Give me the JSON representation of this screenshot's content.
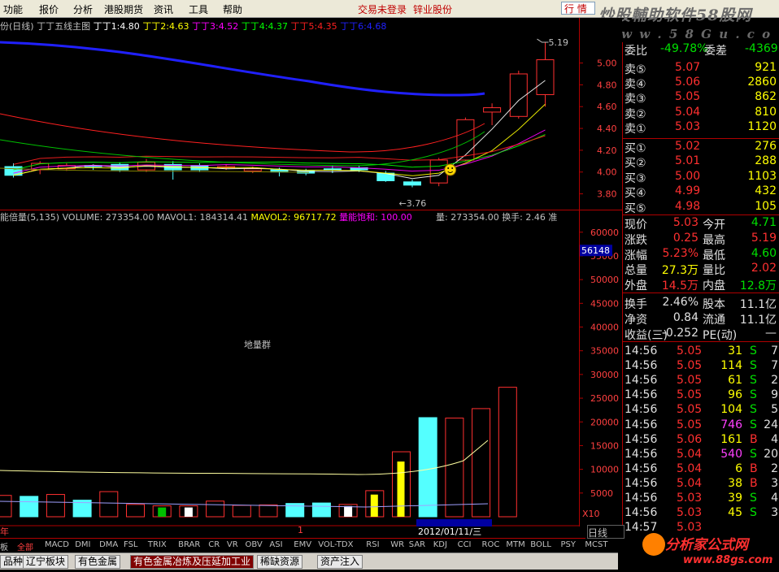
{
  "menu": {
    "items": [
      "功能",
      "报价",
      "分析",
      "港股期货",
      "资讯",
      "工具",
      "帮助"
    ],
    "status": "交易未登录",
    "stock_name": "锌业股份",
    "search_text": "行 情"
  },
  "watermark": {
    "line1": "炒股輔助软件58股网",
    "line2": "w w w . 5 8 G u . c o m"
  },
  "kline_header": {
    "title": "份(日线)",
    "indicator": "丁丁五线主图",
    "items": [
      {
        "label": "丁丁1:",
        "value": "4.80",
        "color": "#ffffff"
      },
      {
        "label": "丁丁2:",
        "value": "4.63",
        "color": "#ffff00"
      },
      {
        "label": "丁丁3:",
        "value": "4.52",
        "color": "#ff00ff"
      },
      {
        "label": "丁丁4:",
        "value": "4.37",
        "color": "#00ff00"
      },
      {
        "label": "丁丁5:",
        "value": "4.35",
        "color": "#ff2020"
      },
      {
        "label": "丁丁6:",
        "value": "4.68",
        "color": "#2020ff"
      }
    ]
  },
  "kline": {
    "yticks": [
      "5.00",
      "4.80",
      "4.60",
      "4.40",
      "4.20",
      "4.00",
      "3.80"
    ],
    "high_label": "5.19",
    "low_label": "←3.76",
    "candles": [
      {
        "o": 4.05,
        "c": 3.97,
        "h": 4.08,
        "l": 3.95
      },
      {
        "o": 4.02,
        "c": 4.08,
        "h": 4.1,
        "l": 3.98
      },
      {
        "o": 4.03,
        "c": 4.06,
        "h": 4.08,
        "l": 4.01
      },
      {
        "o": 4.06,
        "c": 4.05,
        "h": 4.07,
        "l": 4.02
      },
      {
        "o": 4.07,
        "c": 4.02,
        "h": 4.09,
        "l": 4.0
      },
      {
        "o": 4.02,
        "c": 4.09,
        "h": 4.12,
        "l": 4.0
      },
      {
        "o": 4.07,
        "c": 4.02,
        "h": 4.1,
        "l": 3.93
      },
      {
        "o": 4.06,
        "c": 4.02,
        "h": 4.08,
        "l": 4.0
      },
      {
        "o": 4.05,
        "c": 4.05,
        "h": 4.07,
        "l": 4.02
      },
      {
        "o": 4.01,
        "c": 4.03,
        "h": 4.05,
        "l": 3.99
      },
      {
        "o": 4.02,
        "c": 4.0,
        "h": 4.04,
        "l": 3.96
      },
      {
        "o": 4.01,
        "c": 3.99,
        "h": 4.03,
        "l": 3.97
      },
      {
        "o": 4.03,
        "c": 4.02,
        "h": 4.06,
        "l": 3.99
      },
      {
        "o": 4.04,
        "c": 4.02,
        "h": 4.06,
        "l": 4.0
      },
      {
        "o": 3.99,
        "c": 3.92,
        "h": 4.01,
        "l": 3.91
      },
      {
        "o": 3.91,
        "c": 3.88,
        "h": 3.93,
        "l": 3.86
      },
      {
        "o": 3.9,
        "c": 4.11,
        "h": 4.13,
        "l": 3.87
      },
      {
        "o": 4.11,
        "c": 4.48,
        "h": 4.5,
        "l": 4.1
      },
      {
        "o": 4.55,
        "c": 4.59,
        "h": 4.63,
        "l": 4.43
      },
      {
        "o": 4.51,
        "c": 4.9,
        "h": 4.93,
        "l": 4.49
      },
      {
        "o": 4.71,
        "c": 5.03,
        "h": 5.19,
        "l": 4.6
      }
    ]
  },
  "vol_header": {
    "title": "能倍量(5,135)",
    "volume": "VOLUME: 273354.00",
    "mavol1": "MAVOL1: 184314.41",
    "mavol2": "MAVOL2: 96717.72",
    "saturation": "量能饱和: 100.00",
    "right": "量: 273354.00",
    "turnover": "换手: 2.46",
    "turnover_mark": "准"
  },
  "volume": {
    "yticks": [
      "60000",
      "55000",
      "50000",
      "45000",
      "40000",
      "35000",
      "30000",
      "25000",
      "20000",
      "15000",
      "10000",
      "5000"
    ],
    "current_label": "56148",
    "multiplier": "X10",
    "ground_label": "地量群",
    "bars": [
      {
        "v": 4500,
        "type": "down"
      },
      {
        "v": 4300,
        "type": "cyan"
      },
      {
        "v": 4700,
        "type": "down"
      },
      {
        "v": 3500,
        "type": "cyan"
      },
      {
        "v": 5300,
        "type": "down"
      },
      {
        "v": 2600,
        "type": "down"
      },
      {
        "v": 2300,
        "type": "green"
      },
      {
        "v": 2300,
        "type": "white"
      },
      {
        "v": 3300,
        "type": "down"
      },
      {
        "v": 2400,
        "type": "down"
      },
      {
        "v": 2500,
        "type": "down"
      },
      {
        "v": 2800,
        "type": "cyan"
      },
      {
        "v": 2900,
        "type": "cyan"
      },
      {
        "v": 2600,
        "type": "white"
      },
      {
        "v": 5500,
        "type": "yellow"
      },
      {
        "v": 13700,
        "type": "yellow"
      },
      {
        "v": 20900,
        "type": "cyan"
      },
      {
        "v": 20800,
        "type": "down"
      },
      {
        "v": 22800,
        "type": "down"
      },
      {
        "v": 27300,
        "type": "down"
      }
    ]
  },
  "xaxis": {
    "label_left": "年",
    "label_mid": "1",
    "date_label": "2012/01/11/三"
  },
  "orderbook": {
    "top": {
      "label1": "委比",
      "val1": "-49.78%",
      "label2": "委差",
      "val2": "-4369"
    },
    "asks": [
      {
        "label": "卖⑤",
        "price": "5.07",
        "vol": "921"
      },
      {
        "label": "卖④",
        "price": "5.06",
        "vol": "2860"
      },
      {
        "label": "卖③",
        "price": "5.05",
        "vol": "862"
      },
      {
        "label": "卖②",
        "price": "5.04",
        "vol": "810"
      },
      {
        "label": "卖①",
        "price": "5.03",
        "vol": "1120"
      }
    ],
    "bids": [
      {
        "label": "买①",
        "price": "5.02",
        "vol": "276"
      },
      {
        "label": "买②",
        "price": "5.01",
        "vol": "288"
      },
      {
        "label": "买③",
        "price": "5.00",
        "vol": "1103"
      },
      {
        "label": "买④",
        "price": "4.99",
        "vol": "432"
      },
      {
        "label": "买⑤",
        "price": "4.98",
        "vol": "105"
      }
    ]
  },
  "quote": [
    {
      "l1": "现价",
      "v1": "5.03",
      "c1": "red",
      "l2": "今开",
      "v2": "4.71",
      "c2": "green"
    },
    {
      "l1": "涨跌",
      "v1": "0.25",
      "c1": "red",
      "l2": "最高",
      "v2": "5.19",
      "c2": "red"
    },
    {
      "l1": "涨幅",
      "v1": "5.23%",
      "c1": "red",
      "l2": "最低",
      "v2": "4.60",
      "c2": "green"
    },
    {
      "l1": "总量",
      "v1": "27.3万",
      "c1": "yellow",
      "l2": "量比",
      "v2": "2.02",
      "c2": "red"
    },
    {
      "l1": "外盘",
      "v1": "14.5万",
      "c1": "red",
      "l2": "内盘",
      "v2": "12.8万",
      "c2": "green"
    }
  ],
  "quote2": [
    {
      "l1": "换手",
      "v1": "2.46%",
      "l2": "股本",
      "v2": "11.1亿"
    },
    {
      "l1": "净资",
      "v1": "0.84",
      "l2": "流通",
      "v2": "11.1亿"
    },
    {
      "l1": "收益(三)",
      "v1": "-0.252",
      "l2": "PE(动)",
      "v2": "—"
    }
  ],
  "ticks": [
    {
      "t": "14:56",
      "p": "5.05",
      "v": "31",
      "bs": "S",
      "n": "7",
      "vc": "yellow"
    },
    {
      "t": "14:56",
      "p": "5.05",
      "v": "114",
      "bs": "S",
      "n": "7",
      "vc": "yellow"
    },
    {
      "t": "14:56",
      "p": "5.05",
      "v": "61",
      "bs": "S",
      "n": "2",
      "vc": "yellow"
    },
    {
      "t": "14:56",
      "p": "5.05",
      "v": "96",
      "bs": "S",
      "n": "9",
      "vc": "yellow"
    },
    {
      "t": "14:56",
      "p": "5.05",
      "v": "104",
      "bs": "S",
      "n": "5",
      "vc": "yellow"
    },
    {
      "t": "14:56",
      "p": "5.05",
      "v": "746",
      "bs": "S",
      "n": "24",
      "vc": "magenta"
    },
    {
      "t": "14:56",
      "p": "5.06",
      "v": "161",
      "bs": "B",
      "n": "4",
      "vc": "yellow"
    },
    {
      "t": "14:56",
      "p": "5.04",
      "v": "540",
      "bs": "S",
      "n": "20",
      "vc": "magenta"
    },
    {
      "t": "14:56",
      "p": "5.04",
      "v": "6",
      "bs": "B",
      "n": "2",
      "vc": "yellow"
    },
    {
      "t": "14:56",
      "p": "5.04",
      "v": "38",
      "bs": "B",
      "n": "3",
      "vc": "yellow"
    },
    {
      "t": "14:56",
      "p": "5.03",
      "v": "39",
      "bs": "S",
      "n": "4",
      "vc": "yellow"
    },
    {
      "t": "14:56",
      "p": "5.03",
      "v": "45",
      "bs": "S",
      "n": "3",
      "vc": "yellow"
    },
    {
      "t": "14:57",
      "p": "5.03",
      "v": "",
      "bs": "",
      "n": "",
      "vc": "yellow"
    }
  ],
  "tabs": [
    "板",
    "全部",
    "MACD",
    "DMI",
    "DMA",
    "FSL",
    "TRIX",
    "BRAR",
    "CR",
    "VR",
    "OBV",
    "ASI",
    "EMV",
    "VOL-TDX",
    "RSI",
    "WR",
    "SAR",
    "KDJ",
    "CCI",
    "ROC",
    "MTM",
    "BOLL",
    "PSY",
    "MCST"
  ],
  "sectors": [
    "品种",
    "辽宁板块",
    "有色金属",
    "有色金属冶炼及压延加工业",
    "稀缺资源",
    "资产注入"
  ],
  "day_tab": "日线",
  "brand": {
    "name": "分析家公式网",
    "url": "www.88gs.com"
  }
}
